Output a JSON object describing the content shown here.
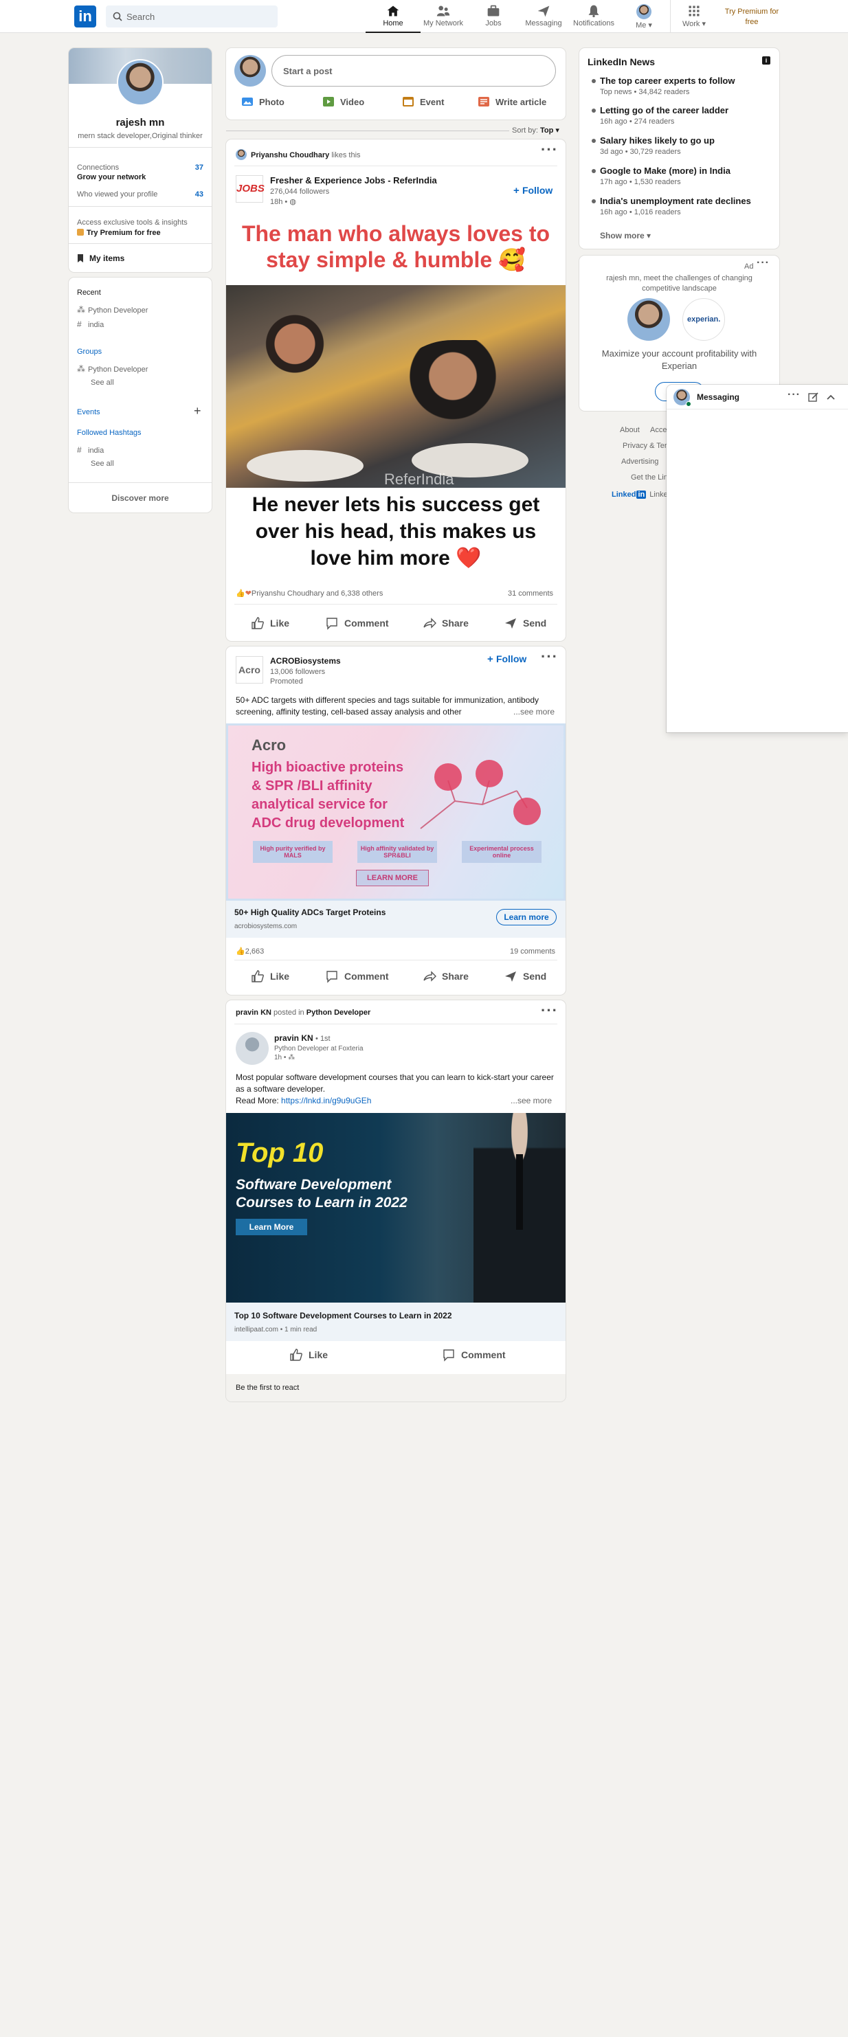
{
  "header": {
    "search_placeholder": "Search",
    "nav": [
      {
        "label": "Home",
        "icon": "home-icon"
      },
      {
        "label": "My Network",
        "icon": "network-icon"
      },
      {
        "label": "Jobs",
        "icon": "jobs-icon"
      },
      {
        "label": "Messaging",
        "icon": "messaging-icon"
      },
      {
        "label": "Notifications",
        "icon": "notifications-icon"
      },
      {
        "label": "Me",
        "icon": "me-avatar"
      },
      {
        "label": "Work",
        "icon": "work-grid-icon"
      }
    ],
    "premium": "Try Premium for free"
  },
  "profile": {
    "name": "rajesh mn",
    "headline": "mern stack developer,Original thinker",
    "connections_label": "Connections",
    "connections_sub": "Grow your network",
    "connections_count": "37",
    "views_label": "Who viewed your profile",
    "views_count": "43",
    "premium_text": "Access exclusive tools & insights",
    "premium_link": "Try Premium for free",
    "my_items": "My items"
  },
  "sidebar": {
    "recent_title": "Recent",
    "recent": [
      "Python Developer",
      "india"
    ],
    "groups_title": "Groups",
    "groups": [
      "Python Developer"
    ],
    "see_all_1": "See all",
    "events_title": "Events",
    "hashtags_title": "Followed Hashtags",
    "hashtags": [
      "india"
    ],
    "see_all_2": "See all",
    "discover": "Discover more"
  },
  "composer": {
    "placeholder": "Start a post",
    "actions": [
      "Photo",
      "Video",
      "Event",
      "Write article"
    ],
    "sort_label": "Sort by:",
    "sort_value": "Top"
  },
  "post1": {
    "liker": "Priyanshu Choudhary",
    "likes_this": "likes this",
    "org": "Fresher & Experience Jobs - ReferIndia",
    "followers": "276,044 followers",
    "time": "18h •",
    "follow": "Follow",
    "logo_text": "JOBS",
    "img_top": "The man who always loves to stay simple & humble 🥰",
    "img_watermark": "ReferIndia",
    "img_bottom": "He never lets his success get over his head, this makes us love him more ❤️",
    "reactions": "Priyanshu Choudhary and 6,338 others",
    "comments": "31 comments"
  },
  "actions": {
    "like": "Like",
    "comment": "Comment",
    "share": "Share",
    "send": "Send"
  },
  "post2": {
    "org": "ACROBiosystems",
    "followers": "13,006 followers",
    "promoted": "Promoted",
    "follow": "Follow",
    "logo_text": "Acro",
    "text": "50+ ADC targets with different species and tags suitable for immunization, antibody screening, affinity testing, cell-based assay analysis and other",
    "see_more": "...see more",
    "ad_logo": "Acro",
    "ad_headline": "High bioactive proteins & SPR /BLI affinity analytical service for ADC drug development",
    "ad_box1": "High purity verified by MALS",
    "ad_box2": "High affinity validated by SPR&BLI",
    "ad_box3": "Experimental process online",
    "ad_cta": "LEARN MORE",
    "link_title": "50+ High Quality ADCs Target Proteins",
    "link_domain": "acrobiosystems.com",
    "learn_more": "Learn more",
    "reactions": "2,663",
    "comments": "19 comments"
  },
  "post3": {
    "poster": "pravin KN",
    "posted_in": "posted in",
    "group": "Python Developer",
    "author": "pravin KN",
    "degree": "• 1st",
    "author_title": "Python Developer at Foxteria",
    "time": "1h •",
    "text": "Most popular software development courses that you can learn to kick-start your career as a software developer.",
    "read_more": "Read More:",
    "url": "https://lnkd.in/g9u9uGEh",
    "see_more": "...see more",
    "img_line1": "Top 10",
    "img_line2": "Software Development Courses to Learn in 2022",
    "img_btn": "Learn More",
    "link_title": "Top 10 Software Development Courses to Learn in 2022",
    "link_meta": "intellipaat.com • 1 min read",
    "like": "Like",
    "comment": "Comment",
    "first_react": "Be the first to react"
  },
  "news": {
    "title": "LinkedIn News",
    "items": [
      {
        "title": "The top career experts to follow",
        "sub": "Top news • 34,842 readers"
      },
      {
        "title": "Letting go of the career ladder",
        "sub": "16h ago • 274 readers"
      },
      {
        "title": "Salary hikes likely to go up",
        "sub": "3d ago • 30,729 readers"
      },
      {
        "title": "Google to Make (more) in India",
        "sub": "17h ago • 1,530 readers"
      },
      {
        "title": "India's unemployment rate declines",
        "sub": "16h ago • 1,016 readers"
      }
    ],
    "show_more": "Show more"
  },
  "ad": {
    "label": "Ad",
    "text": "rajesh mn, meet the challenges of changing competitive landscape",
    "brand": "experian.",
    "body": "Maximize your account profitability with Experian"
  },
  "footer": {
    "links": [
      "About",
      "Acce",
      "Privacy & Ter",
      "Advertising",
      "Get the Lin"
    ],
    "brand": "Linked",
    "brand_in": "in",
    "brand_tail": "Linke"
  },
  "messaging": {
    "title": "Messaging"
  },
  "colors": {
    "brand": "#0a66c2",
    "background": "#f3f2ef",
    "premium": "#915907"
  }
}
